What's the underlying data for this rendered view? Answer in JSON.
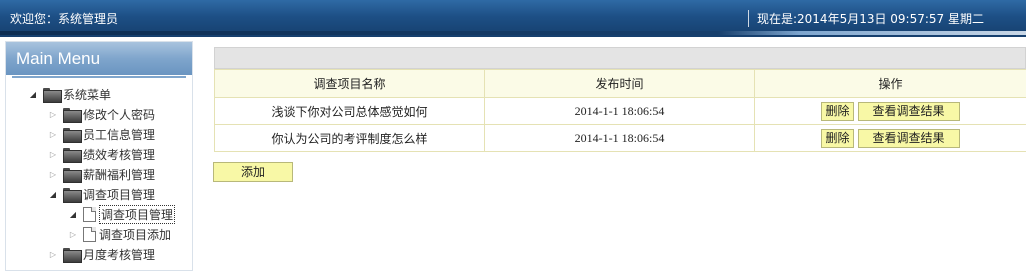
{
  "topbar": {
    "welcome": "欢迎您：系统管理员",
    "datetime": "现在是:2014年5月13日  09:57:57 星期二"
  },
  "sidebar": {
    "title": "Main Menu",
    "root": "系统菜单",
    "items": [
      {
        "label": "修改个人密码"
      },
      {
        "label": "员工信息管理"
      },
      {
        "label": "绩效考核管理"
      },
      {
        "label": "薪酬福利管理"
      },
      {
        "label": "调查项目管理"
      },
      {
        "label": "月度考核管理"
      }
    ],
    "subitems": [
      {
        "label": "调查项目管理"
      },
      {
        "label": "调查项目添加"
      }
    ]
  },
  "table": {
    "headers": [
      "调查项目名称",
      "发布时间",
      "操作"
    ],
    "rows": [
      {
        "name": "浅谈下你对公司总体感觉如何",
        "time": "2014-1-1 18:06:54",
        "delete": "删除",
        "view": "查看调查结果"
      },
      {
        "name": "你认为公司的考评制度怎么样",
        "time": "2014-1-1 18:06:54",
        "delete": "删除",
        "view": "查看调查结果"
      }
    ]
  },
  "add_button": "添加",
  "colors": {
    "topbar": "#1d4f85",
    "sidebar_header": "#7fa5cc",
    "table_header_bg": "#fbfbe7",
    "button_bg": "#f8f8a6"
  }
}
